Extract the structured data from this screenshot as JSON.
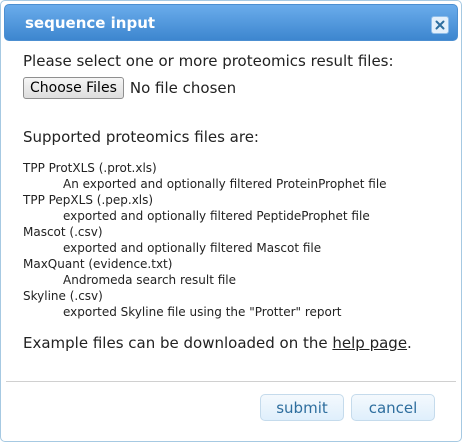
{
  "dialog": {
    "title": "sequence input",
    "close_icon": "close-icon"
  },
  "form": {
    "prompt": "Please select one or more proteomics result files:",
    "choose_files_label": "Choose Files",
    "no_file_text": "No file chosen",
    "supported_heading": "Supported proteomics files are:",
    "formats": [
      {
        "name": "TPP ProtXLS (.prot.xls)",
        "description": "An exported and optionally filtered ProteinProphet file"
      },
      {
        "name": "TPP PepXLS (.pep.xls)",
        "description": "exported and optionally filtered PeptideProphet file"
      },
      {
        "name": "Mascot (.csv)",
        "description": "exported and optionally filtered Mascot file"
      },
      {
        "name": "MaxQuant (evidence.txt)",
        "description": "Andromeda search result file"
      },
      {
        "name": "Skyline (.csv)",
        "description": "exported Skyline file using the \"Protter\" report"
      }
    ],
    "example_prefix": "Example files can be downloaded on the ",
    "help_link_text": "help page",
    "example_suffix": "."
  },
  "buttons": {
    "submit_label": "submit",
    "cancel_label": "cancel"
  },
  "colors": {
    "titlebar": "#4a93db",
    "border": "#a6c9e2",
    "button_text": "#2e6e9e"
  }
}
